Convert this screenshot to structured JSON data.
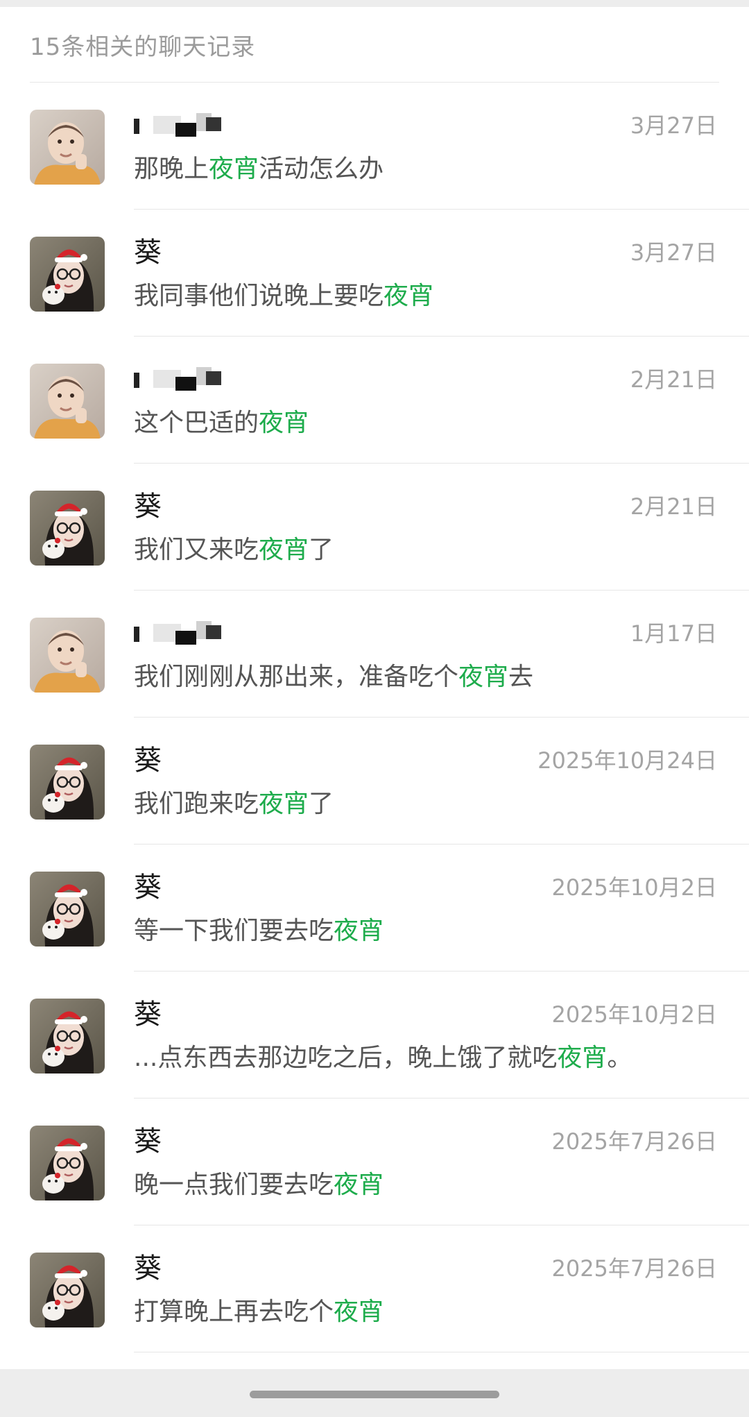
{
  "header": {
    "title": "15条相关的聊天记录"
  },
  "results": [
    {
      "name": "",
      "redacted": true,
      "avatar": "child-photo",
      "date": "3月27日",
      "before": "那晚上",
      "keyword": "夜宵",
      "after": "活动怎么办"
    },
    {
      "name": "葵",
      "redacted": false,
      "avatar": "girl-santa-hat-photo",
      "date": "3月27日",
      "before": "我同事他们说晚上要吃",
      "keyword": "夜宵",
      "after": ""
    },
    {
      "name": "",
      "redacted": true,
      "avatar": "child-photo",
      "date": "2月21日",
      "before": "这个巴适的",
      "keyword": "夜宵",
      "after": ""
    },
    {
      "name": "葵",
      "redacted": false,
      "avatar": "girl-santa-hat-photo",
      "date": "2月21日",
      "before": "我们又来吃",
      "keyword": "夜宵",
      "after": "了"
    },
    {
      "name": "",
      "redacted": true,
      "avatar": "child-photo",
      "date": "1月17日",
      "before": "我们刚刚从那出来，准备吃个",
      "keyword": "夜宵",
      "after": "去"
    },
    {
      "name": "葵",
      "redacted": false,
      "avatar": "girl-santa-hat-photo",
      "date": "2025年10月24日",
      "before": "我们跑来吃",
      "keyword": "夜宵",
      "after": "了"
    },
    {
      "name": "葵",
      "redacted": false,
      "avatar": "girl-santa-hat-photo",
      "date": "2025年10月2日",
      "before": "等一下我们要去吃",
      "keyword": "夜宵",
      "after": ""
    },
    {
      "name": "葵",
      "redacted": false,
      "avatar": "girl-santa-hat-photo",
      "date": "2025年10月2日",
      "before": "...点东西去那边吃之后，晚上饿了就吃",
      "keyword": "夜宵",
      "after": "。"
    },
    {
      "name": "葵",
      "redacted": false,
      "avatar": "girl-santa-hat-photo",
      "date": "2025年7月26日",
      "before": "晚一点我们要去吃",
      "keyword": "夜宵",
      "after": ""
    },
    {
      "name": "葵",
      "redacted": false,
      "avatar": "girl-santa-hat-photo",
      "date": "2025年7月26日",
      "before": "打算晚上再去吃个",
      "keyword": "夜宵",
      "after": ""
    }
  ],
  "colors": {
    "highlight": "#1eac4c",
    "date": "#a4a4a4",
    "message": "#555555",
    "name": "#1a1a1a"
  }
}
